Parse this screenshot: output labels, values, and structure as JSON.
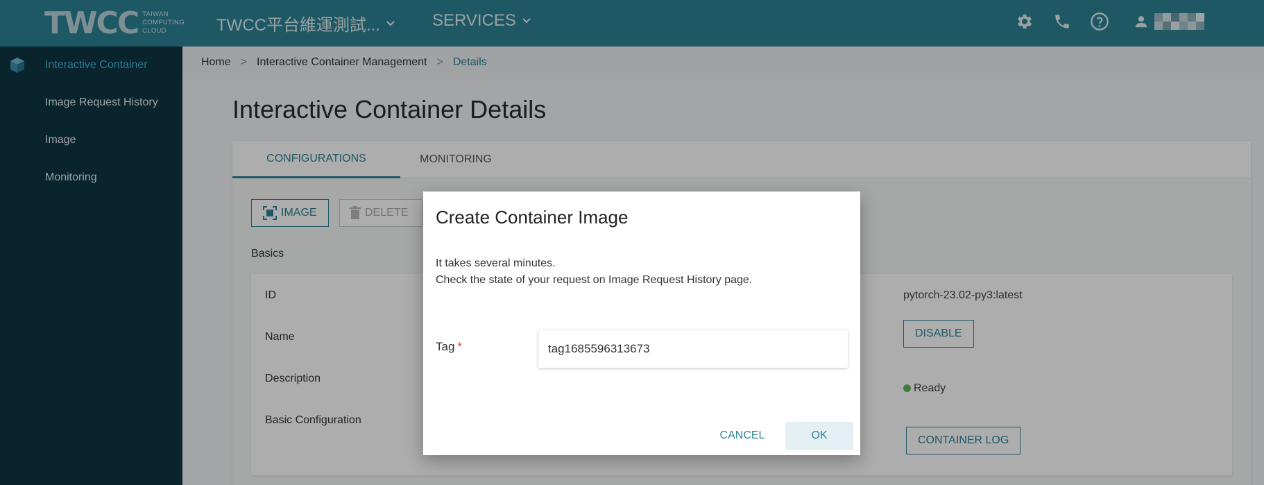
{
  "header": {
    "logo_text": "TWCC",
    "logo_sub": [
      "TAIWAN",
      "COMPUTING",
      "CLOUD"
    ],
    "project_label": "TWCC平台維運測試...",
    "services_label": "SERVICES",
    "icons": [
      "gear-icon",
      "phone-icon",
      "help-icon",
      "user-icon"
    ]
  },
  "sidebar": {
    "items": [
      {
        "label": "Interactive Container",
        "active": true,
        "icon": "cube-icon"
      },
      {
        "label": "Image Request History"
      },
      {
        "label": "Image"
      },
      {
        "label": "Monitoring"
      }
    ]
  },
  "breadcrumb": {
    "home": "Home",
    "middle": "Interactive Container Management",
    "current": "Details",
    "separator": ">"
  },
  "page": {
    "title": "Interactive Container Details",
    "tabs": [
      "CONFIGURATIONS",
      "MONITORING"
    ],
    "toolbar": {
      "image_label": "IMAGE",
      "delete_label": "DELETE"
    },
    "basics_label": "Basics",
    "details": {
      "labels": [
        "ID",
        "Name",
        "Description",
        "Basic Configuration"
      ],
      "image_value": "pytorch-23.02-py3:latest",
      "disable_label": "DISABLE",
      "status": "Ready",
      "container_log_label": "CONTAINER LOG"
    }
  },
  "dialog": {
    "title": "Create Container Image",
    "line1": "It takes several minutes.",
    "line2": "Check the state of your request on Image Request History page.",
    "tag_label": "Tag",
    "required_mark": "*",
    "tag_value": "tag1685596313673",
    "cancel_label": "CANCEL",
    "ok_label": "OK"
  },
  "colors": {
    "header": "#2e8296",
    "sidebar": "#0f3545",
    "accent": "#2e8296",
    "active_nav": "#3fb1d6",
    "status_ready": "#5cb85c"
  }
}
